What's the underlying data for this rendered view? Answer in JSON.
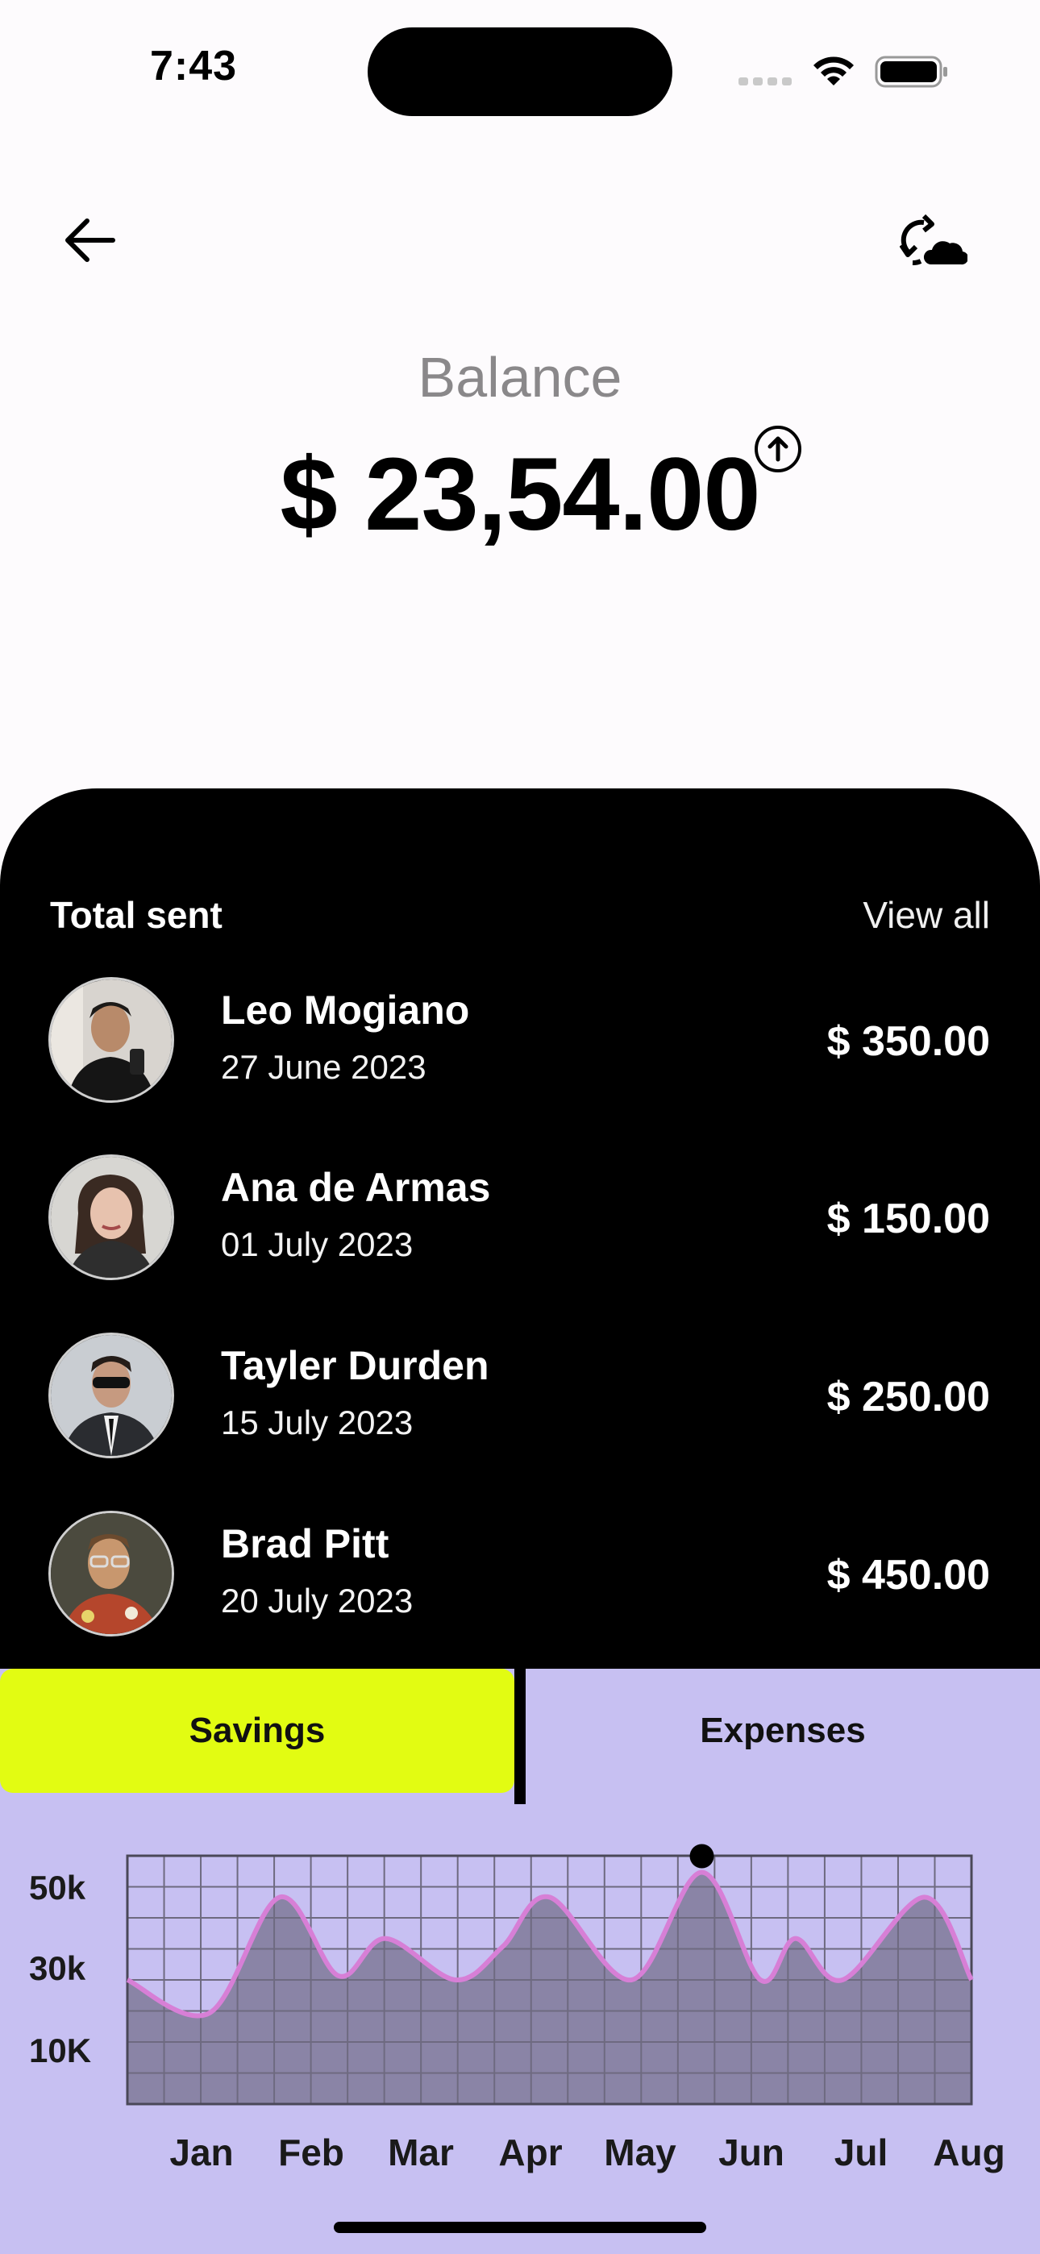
{
  "status_bar": {
    "time": "7:43",
    "icons": [
      "cellular-signal-icon",
      "wifi-icon",
      "battery-icon"
    ]
  },
  "top_bar": {
    "back_icon": "arrow-left-icon",
    "action_icon": "sync-cloud-icon"
  },
  "balance": {
    "label": "Balance",
    "amount": "$ 23,54.00",
    "indicator_icon": "arrow-up-circle-icon"
  },
  "total_sent": {
    "title": "Total sent",
    "view_all": "View all",
    "transactions": [
      {
        "name": "Leo Mogiano",
        "date": "27 June 2023",
        "amount": "$ 350.00"
      },
      {
        "name": "Ana de Armas",
        "date": "01 July 2023",
        "amount": "$ 150.00"
      },
      {
        "name": "Tayler Durden",
        "date": "15 July 2023",
        "amount": "$ 250.00"
      },
      {
        "name": "Brad Pitt",
        "date": "20 July 2023",
        "amount": "$ 450.00"
      }
    ]
  },
  "tabs": {
    "savings": "Savings",
    "expenses": "Expenses",
    "active": "Savings"
  },
  "colors": {
    "accent_green": "#e2fc12",
    "chart_bg": "#c7c0f2",
    "chart_fill": "#8a84a6",
    "chart_line": "#d77fd6"
  },
  "chart_data": {
    "type": "area",
    "x": [
      "Jan",
      "Feb",
      "Mar",
      "Apr",
      "May",
      "Jun",
      "Jul",
      "Aug"
    ],
    "y_tick_labels": [
      "50k",
      "30k",
      "10K"
    ],
    "y_ticks": [
      50,
      30,
      10
    ],
    "ylim": [
      0,
      60
    ],
    "grid": true,
    "highlight": {
      "x": "Jun",
      "value": 56
    },
    "points": [
      {
        "x": 0.0,
        "y": 30
      },
      {
        "x": 0.7,
        "y": 22
      },
      {
        "x": 1.3,
        "y": 50
      },
      {
        "x": 1.8,
        "y": 31
      },
      {
        "x": 2.2,
        "y": 40
      },
      {
        "x": 2.8,
        "y": 30
      },
      {
        "x": 3.2,
        "y": 38
      },
      {
        "x": 3.6,
        "y": 50
      },
      {
        "x": 4.3,
        "y": 30
      },
      {
        "x": 4.9,
        "y": 56
      },
      {
        "x": 5.4,
        "y": 30
      },
      {
        "x": 5.7,
        "y": 40
      },
      {
        "x": 6.1,
        "y": 30
      },
      {
        "x": 6.8,
        "y": 50
      },
      {
        "x": 7.2,
        "y": 30
      }
    ]
  }
}
